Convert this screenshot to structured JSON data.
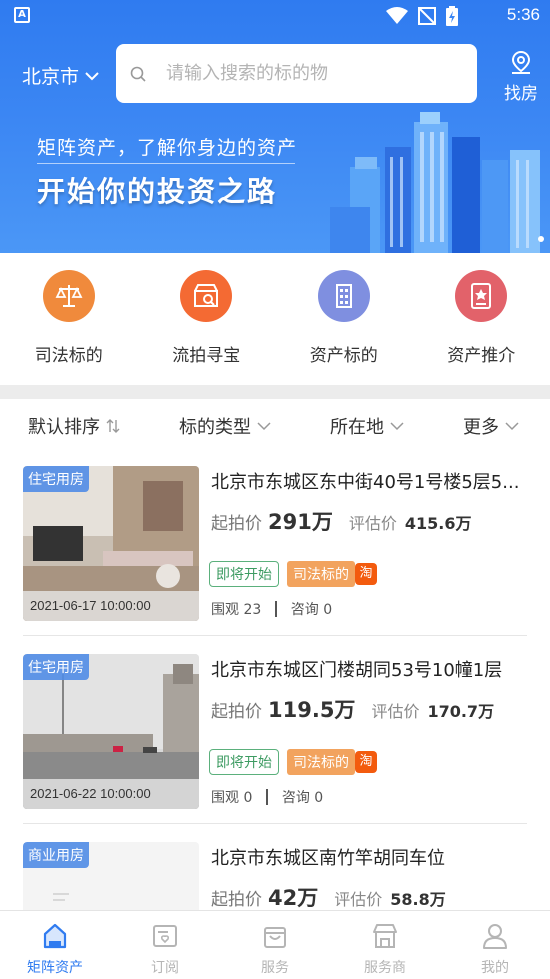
{
  "status_bar": {
    "time": "5:36"
  },
  "header": {
    "city": "北京市",
    "search_placeholder": "请输入搜索的标的物",
    "find_label": "找房"
  },
  "banner": {
    "line1": "矩阵资产，了解你身边的资产",
    "line2": "开始你的投资之路"
  },
  "categories": [
    {
      "label": "司法标的",
      "icon": "scales-icon",
      "color": "#f08a3c"
    },
    {
      "label": "流拍寻宝",
      "icon": "shop-search-icon",
      "color": "#f46a33"
    },
    {
      "label": "资产标的",
      "icon": "building-icon",
      "color": "#7f8fe0"
    },
    {
      "label": "资产推介",
      "icon": "certificate-icon",
      "color": "#e2626a"
    }
  ],
  "filters": {
    "sort": "默认排序",
    "type": "标的类型",
    "location": "所在地",
    "more": "更多"
  },
  "listings": [
    {
      "tag": "住宅用房",
      "time": "2021-06-17 10:00:00",
      "title": "北京市东城区东中街40号1号楼5层5...",
      "start_label": "起拍价",
      "start_price": "291万",
      "eval_label": "评估价",
      "eval_price": "415.6万",
      "badge_status": "即将开始",
      "badge_type": "司法标的",
      "badge_tao": "淘",
      "views": "围观 23",
      "inquiries": "咨询 0"
    },
    {
      "tag": "住宅用房",
      "time": "2021-06-22 10:00:00",
      "title": "北京市东城区门楼胡同53号10幢1层",
      "start_label": "起拍价",
      "start_price": "119.5万",
      "eval_label": "评估价",
      "eval_price": "170.7万",
      "badge_status": "即将开始",
      "badge_type": "司法标的",
      "badge_tao": "淘",
      "views": "围观 0",
      "inquiries": "咨询 0"
    },
    {
      "tag": "商业用房",
      "title": "北京市东城区南竹竿胡同车位",
      "start_label": "起拍价",
      "start_price": "42万",
      "eval_label": "评估价",
      "eval_price": "58.8万"
    }
  ],
  "bottom_nav": [
    {
      "label": "矩阵资产",
      "icon": "home-icon",
      "active": true
    },
    {
      "label": "订阅",
      "icon": "subscribe-icon",
      "active": false
    },
    {
      "label": "服务",
      "icon": "service-bag-icon",
      "active": false
    },
    {
      "label": "服务商",
      "icon": "store-icon",
      "active": false
    },
    {
      "label": "我的",
      "icon": "user-icon",
      "active": false
    }
  ],
  "colors": {
    "primary": "#2f7bf0",
    "green": "#3d9b62",
    "orange": "#f2a35e",
    "tao": "#f35b0e"
  }
}
